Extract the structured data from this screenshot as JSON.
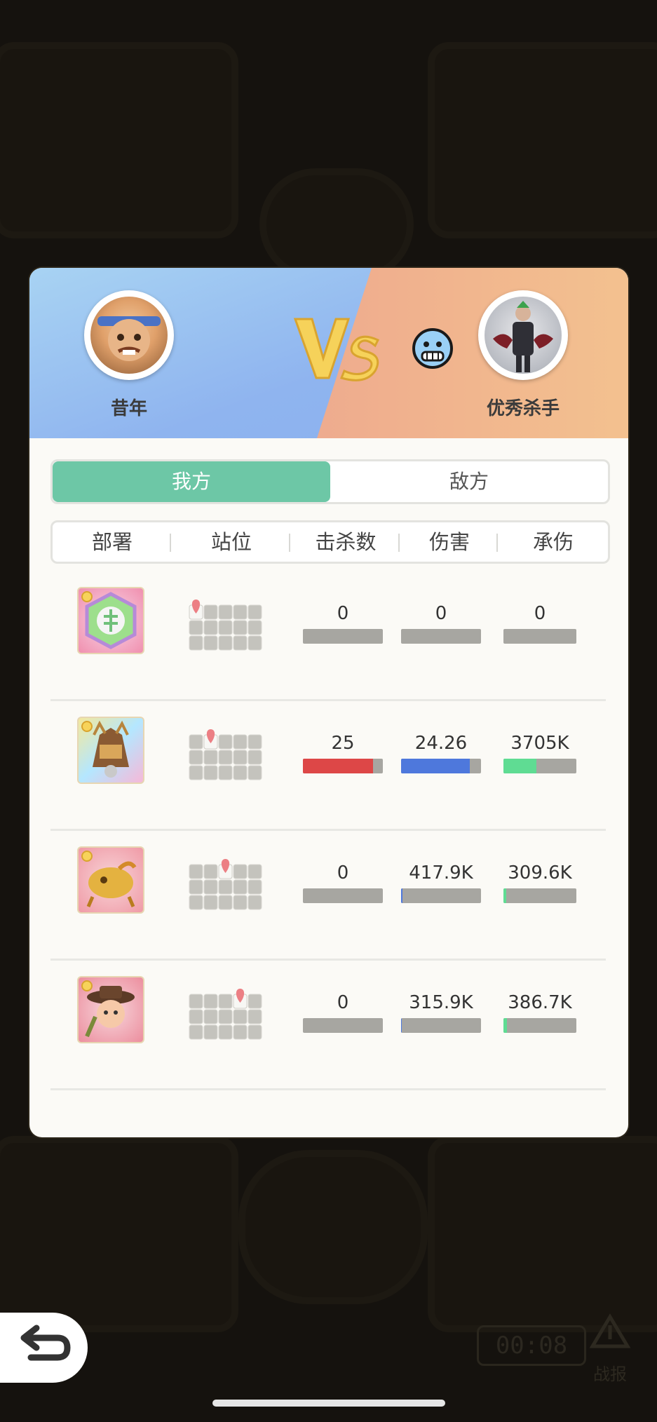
{
  "header": {
    "player_name": "昔年",
    "opponent_name": "优秀杀手",
    "vs_label": "VS"
  },
  "tabs": {
    "ours": "我方",
    "enemy": "敌方",
    "active": "ours"
  },
  "columns": [
    "部署",
    "站位",
    "击杀数",
    "伤害",
    "承伤"
  ],
  "rows": [
    {
      "unit_icon": "crystal-rune-icon",
      "position": 0,
      "kills": "0",
      "kills_fill": 0,
      "damage": "0",
      "damage_fill": 0,
      "taken": "0",
      "taken_fill": 0
    },
    {
      "unit_icon": "armored-beast-icon",
      "position": 1,
      "kills": "25",
      "kills_fill": 0.88,
      "damage": "24.26",
      "damage_fill": 0.86,
      "taken": "3705K",
      "taken_fill": 0.45
    },
    {
      "unit_icon": "golden-dragon-icon",
      "position": 2,
      "kills": "0",
      "kills_fill": 0,
      "damage": "417.9K",
      "damage_fill": 0.02,
      "taken": "309.6K",
      "taken_fill": 0.04
    },
    {
      "unit_icon": "cowboy-girl-icon",
      "position": 3,
      "kills": "0",
      "kills_fill": 0,
      "damage": "315.9K",
      "damage_fill": 0.01,
      "taken": "386.7K",
      "taken_fill": 0.05
    }
  ],
  "colors": {
    "kills": "#dd4747",
    "damage": "#4e78dc",
    "taken": "#5fdc93",
    "track": "#a7a6a1",
    "tab_active": "#6dc7a6"
  },
  "background": {
    "timer": "00:08",
    "report_label": "战报"
  }
}
